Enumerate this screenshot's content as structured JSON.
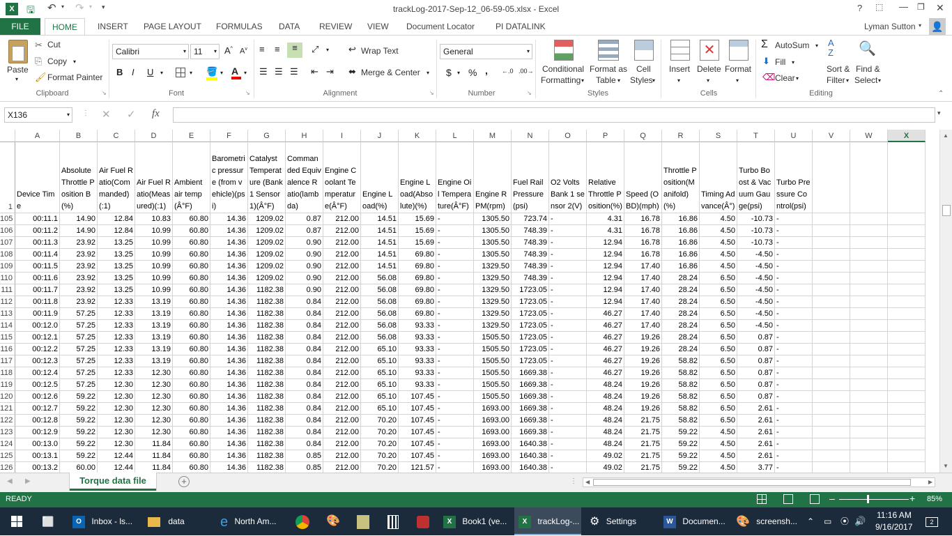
{
  "window": {
    "title": "trackLog-2017-Sep-12_06-59-05.xlsx - Excel",
    "help": "?",
    "user": "Lyman Sutton"
  },
  "tabs": [
    "FILE",
    "HOME",
    "INSERT",
    "PAGE LAYOUT",
    "FORMULAS",
    "DATA",
    "REVIEW",
    "VIEW",
    "Document Locator",
    "PI DATALINK"
  ],
  "ribbon": {
    "clipboard": {
      "paste": "Paste",
      "cut": "Cut",
      "copy": "Copy",
      "format_painter": "Format Painter",
      "label": "Clipboard"
    },
    "font": {
      "name": "Calibri",
      "size": "11",
      "label": "Font",
      "bold": "B",
      "italic": "I",
      "underline": "U"
    },
    "alignment": {
      "wrap_text": "Wrap Text",
      "merge": "Merge & Center",
      "label": "Alignment"
    },
    "number": {
      "format": "General",
      "label": "Number",
      "currency": "$",
      "percent": "%",
      "comma": ","
    },
    "styles": {
      "conditional": "Conditional",
      "conditional2": "Formatting",
      "format_table": "Format as",
      "format_table2": "Table",
      "cell_styles": "Cell",
      "cell_styles2": "Styles",
      "label": "Styles"
    },
    "cells": {
      "insert": "Insert",
      "delete": "Delete",
      "format": "Format",
      "label": "Cells"
    },
    "editing": {
      "autosum": "AutoSum",
      "fill": "Fill",
      "clear": "Clear",
      "sort": "Sort &",
      "sort2": "Filter",
      "find": "Find &",
      "find2": "Select",
      "label": "Editing"
    }
  },
  "formula_bar": {
    "name_box": "X136",
    "fx": "fx",
    "content": ""
  },
  "columns": [
    "A",
    "B",
    "C",
    "D",
    "E",
    "F",
    "G",
    "H",
    "I",
    "J",
    "K",
    "L",
    "M",
    "N",
    "O",
    "P",
    "Q",
    "R",
    "S",
    "T",
    "U",
    "V",
    "W",
    "X"
  ],
  "header_row_num": "1",
  "headers": [
    "Device Time",
    "Absolute Throttle Position B(%)",
    "Air Fuel Ratio(Commanded)(:1)",
    "Air Fuel Ratio(Measured)(:1)",
    "Ambient air temp(Â°F)",
    "Barometric pressure (from vehicle)(psi)",
    "Catalyst Temperature (Bank 1 Sensor 1)(Â°F)",
    "Commanded Equivalence Ratio(lambda)",
    "Engine Coolant Temperature(Â°F)",
    "Engine Load(%)",
    "Engine Load(Absolute)(%)",
    "Engine Oil Temperature(Â°F)",
    "Engine RPM(rpm)",
    "Fuel Rail Pressure (psi)",
    "O2 Volts Bank 1 sensor 2(V)",
    "Relative Throttle Position(%)",
    "Speed (OBD)(mph)",
    "Throttle Position(Manifold)(%)",
    "Timing Advance(Â°)",
    "Turbo Boost & Vacuum Gauge(psi)",
    "Turbo Pressure Control(psi)",
    "",
    "",
    ""
  ],
  "rows": [
    {
      "n": "105",
      "v": [
        "00:11.1",
        "14.90",
        "12.84",
        "10.83",
        "60.80",
        "14.36",
        "1209.02",
        "0.87",
        "212.00",
        "14.51",
        "15.69",
        "-",
        "1305.50",
        "723.74",
        "-",
        "4.31",
        "16.78",
        "16.86",
        "4.50",
        "-10.73",
        "-"
      ]
    },
    {
      "n": "106",
      "v": [
        "00:11.2",
        "14.90",
        "12.84",
        "10.99",
        "60.80",
        "14.36",
        "1209.02",
        "0.87",
        "212.00",
        "14.51",
        "15.69",
        "-",
        "1305.50",
        "748.39",
        "-",
        "4.31",
        "16.78",
        "16.86",
        "4.50",
        "-10.73",
        "-"
      ]
    },
    {
      "n": "107",
      "v": [
        "00:11.3",
        "23.92",
        "13.25",
        "10.99",
        "60.80",
        "14.36",
        "1209.02",
        "0.90",
        "212.00",
        "14.51",
        "15.69",
        "-",
        "1305.50",
        "748.39",
        "-",
        "12.94",
        "16.78",
        "16.86",
        "4.50",
        "-10.73",
        "-"
      ]
    },
    {
      "n": "108",
      "v": [
        "00:11.4",
        "23.92",
        "13.25",
        "10.99",
        "60.80",
        "14.36",
        "1209.02",
        "0.90",
        "212.00",
        "14.51",
        "69.80",
        "-",
        "1305.50",
        "748.39",
        "-",
        "12.94",
        "16.78",
        "16.86",
        "4.50",
        "-4.50",
        "-"
      ]
    },
    {
      "n": "109",
      "v": [
        "00:11.5",
        "23.92",
        "13.25",
        "10.99",
        "60.80",
        "14.36",
        "1209.02",
        "0.90",
        "212.00",
        "14.51",
        "69.80",
        "-",
        "1329.50",
        "748.39",
        "-",
        "12.94",
        "17.40",
        "16.86",
        "4.50",
        "-4.50",
        "-"
      ]
    },
    {
      "n": "110",
      "v": [
        "00:11.6",
        "23.92",
        "13.25",
        "10.99",
        "60.80",
        "14.36",
        "1209.02",
        "0.90",
        "212.00",
        "56.08",
        "69.80",
        "-",
        "1329.50",
        "748.39",
        "-",
        "12.94",
        "17.40",
        "28.24",
        "6.50",
        "-4.50",
        "-"
      ]
    },
    {
      "n": "111",
      "v": [
        "00:11.7",
        "23.92",
        "13.25",
        "10.99",
        "60.80",
        "14.36",
        "1182.38",
        "0.90",
        "212.00",
        "56.08",
        "69.80",
        "-",
        "1329.50",
        "1723.05",
        "-",
        "12.94",
        "17.40",
        "28.24",
        "6.50",
        "-4.50",
        "-"
      ]
    },
    {
      "n": "112",
      "v": [
        "00:11.8",
        "23.92",
        "12.33",
        "13.19",
        "60.80",
        "14.36",
        "1182.38",
        "0.84",
        "212.00",
        "56.08",
        "69.80",
        "-",
        "1329.50",
        "1723.05",
        "-",
        "12.94",
        "17.40",
        "28.24",
        "6.50",
        "-4.50",
        "-"
      ]
    },
    {
      "n": "113",
      "v": [
        "00:11.9",
        "57.25",
        "12.33",
        "13.19",
        "60.80",
        "14.36",
        "1182.38",
        "0.84",
        "212.00",
        "56.08",
        "69.80",
        "-",
        "1329.50",
        "1723.05",
        "-",
        "46.27",
        "17.40",
        "28.24",
        "6.50",
        "-4.50",
        "-"
      ]
    },
    {
      "n": "114",
      "v": [
        "00:12.0",
        "57.25",
        "12.33",
        "13.19",
        "60.80",
        "14.36",
        "1182.38",
        "0.84",
        "212.00",
        "56.08",
        "93.33",
        "-",
        "1329.50",
        "1723.05",
        "-",
        "46.27",
        "17.40",
        "28.24",
        "6.50",
        "-4.50",
        "-"
      ]
    },
    {
      "n": "115",
      "v": [
        "00:12.1",
        "57.25",
        "12.33",
        "13.19",
        "60.80",
        "14.36",
        "1182.38",
        "0.84",
        "212.00",
        "56.08",
        "93.33",
        "-",
        "1505.50",
        "1723.05",
        "-",
        "46.27",
        "19.26",
        "28.24",
        "6.50",
        "0.87",
        "-"
      ]
    },
    {
      "n": "116",
      "v": [
        "00:12.2",
        "57.25",
        "12.33",
        "13.19",
        "60.80",
        "14.36",
        "1182.38",
        "0.84",
        "212.00",
        "65.10",
        "93.33",
        "-",
        "1505.50",
        "1723.05",
        "-",
        "46.27",
        "19.26",
        "28.24",
        "6.50",
        "0.87",
        "-"
      ]
    },
    {
      "n": "117",
      "v": [
        "00:12.3",
        "57.25",
        "12.33",
        "13.19",
        "60.80",
        "14.36",
        "1182.38",
        "0.84",
        "212.00",
        "65.10",
        "93.33",
        "-",
        "1505.50",
        "1723.05",
        "-",
        "46.27",
        "19.26",
        "58.82",
        "6.50",
        "0.87",
        "-"
      ]
    },
    {
      "n": "118",
      "v": [
        "00:12.4",
        "57.25",
        "12.33",
        "12.30",
        "60.80",
        "14.36",
        "1182.38",
        "0.84",
        "212.00",
        "65.10",
        "93.33",
        "-",
        "1505.50",
        "1669.38",
        "-",
        "46.27",
        "19.26",
        "58.82",
        "6.50",
        "0.87",
        "-"
      ]
    },
    {
      "n": "119",
      "v": [
        "00:12.5",
        "57.25",
        "12.30",
        "12.30",
        "60.80",
        "14.36",
        "1182.38",
        "0.84",
        "212.00",
        "65.10",
        "93.33",
        "-",
        "1505.50",
        "1669.38",
        "-",
        "48.24",
        "19.26",
        "58.82",
        "6.50",
        "0.87",
        "-"
      ]
    },
    {
      "n": "120",
      "v": [
        "00:12.6",
        "59.22",
        "12.30",
        "12.30",
        "60.80",
        "14.36",
        "1182.38",
        "0.84",
        "212.00",
        "65.10",
        "107.45",
        "-",
        "1505.50",
        "1669.38",
        "-",
        "48.24",
        "19.26",
        "58.82",
        "6.50",
        "0.87",
        "-"
      ]
    },
    {
      "n": "121",
      "v": [
        "00:12.7",
        "59.22",
        "12.30",
        "12.30",
        "60.80",
        "14.36",
        "1182.38",
        "0.84",
        "212.00",
        "65.10",
        "107.45",
        "-",
        "1693.00",
        "1669.38",
        "-",
        "48.24",
        "19.26",
        "58.82",
        "6.50",
        "2.61",
        "-"
      ]
    },
    {
      "n": "122",
      "v": [
        "00:12.8",
        "59.22",
        "12.30",
        "12.30",
        "60.80",
        "14.36",
        "1182.38",
        "0.84",
        "212.00",
        "70.20",
        "107.45",
        "-",
        "1693.00",
        "1669.38",
        "-",
        "48.24",
        "21.75",
        "58.82",
        "6.50",
        "2.61",
        "-"
      ]
    },
    {
      "n": "123",
      "v": [
        "00:12.9",
        "59.22",
        "12.30",
        "12.30",
        "60.80",
        "14.36",
        "1182.38",
        "0.84",
        "212.00",
        "70.20",
        "107.45",
        "-",
        "1693.00",
        "1669.38",
        "-",
        "48.24",
        "21.75",
        "59.22",
        "4.50",
        "2.61",
        "-"
      ]
    },
    {
      "n": "124",
      "v": [
        "00:13.0",
        "59.22",
        "12.30",
        "11.84",
        "60.80",
        "14.36",
        "1182.38",
        "0.84",
        "212.00",
        "70.20",
        "107.45",
        "-",
        "1693.00",
        "1640.38",
        "-",
        "48.24",
        "21.75",
        "59.22",
        "4.50",
        "2.61",
        "-"
      ]
    },
    {
      "n": "125",
      "v": [
        "00:13.1",
        "59.22",
        "12.44",
        "11.84",
        "60.80",
        "14.36",
        "1182.38",
        "0.85",
        "212.00",
        "70.20",
        "107.45",
        "-",
        "1693.00",
        "1640.38",
        "-",
        "49.02",
        "21.75",
        "59.22",
        "4.50",
        "2.61",
        "-"
      ]
    },
    {
      "n": "126",
      "v": [
        "00:13.2",
        "60.00",
        "12.44",
        "11.84",
        "60.80",
        "14.36",
        "1182.38",
        "0.85",
        "212.00",
        "70.20",
        "121.57",
        "-",
        "1693.00",
        "1640.38",
        "-",
        "49.02",
        "21.75",
        "59.22",
        "4.50",
        "3.77",
        "-"
      ]
    }
  ],
  "sheet": {
    "name": "Torque data file",
    "add": "+"
  },
  "status": {
    "ready": "READY",
    "zoom": "85%"
  },
  "taskbar": {
    "items": [
      "Inbox - ls...",
      "data",
      "North Am...",
      "Book1 (ve...",
      "trackLog-...",
      "Settings",
      "Documen...",
      "screensh..."
    ],
    "time": "11:16 AM",
    "date": "9/16/2017",
    "notifications": "2"
  }
}
